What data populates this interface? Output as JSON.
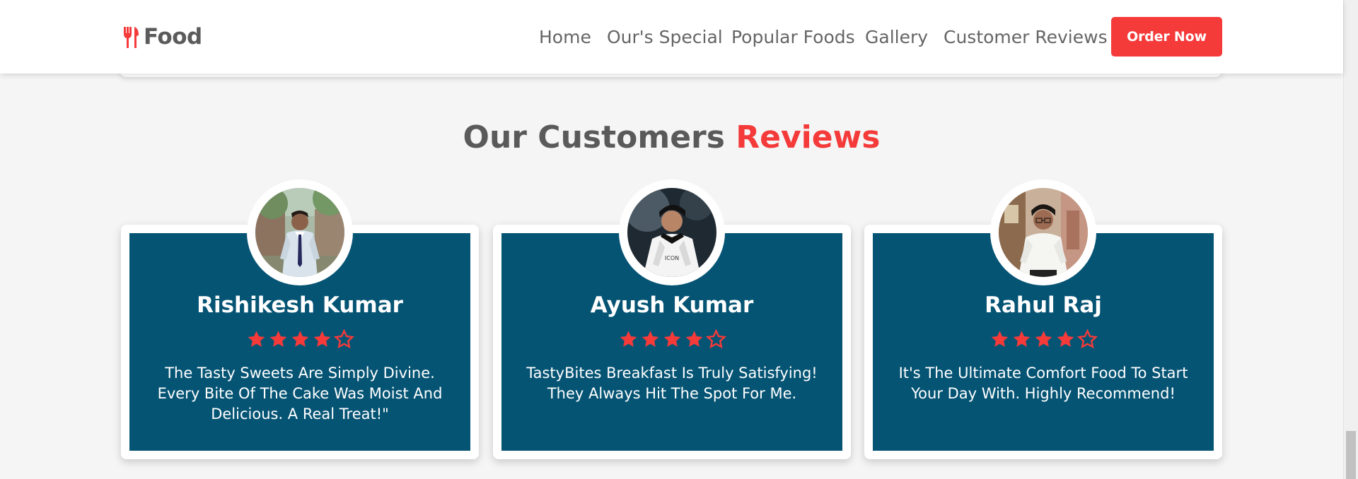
{
  "header": {
    "logo_text": "Food",
    "logo_icon": "fork-knife-icon",
    "nav": [
      {
        "label": "Home"
      },
      {
        "label": "Our's Special"
      },
      {
        "label": "Popular Foods"
      },
      {
        "label": "Gallery"
      },
      {
        "label": "Customer Reviews"
      }
    ],
    "order_button": "Order Now"
  },
  "reviews_section": {
    "title_prefix": "Our Customers",
    "title_accent": "Reviews",
    "cards": [
      {
        "name": "Rishikesh Kumar",
        "rating": 4,
        "max_rating": 5,
        "text": "The Tasty Sweets Are Simply Divine. Every Bite Of The Cake Was Moist And Delicious. A Real Treat!\""
      },
      {
        "name": "Ayush Kumar",
        "rating": 4,
        "max_rating": 5,
        "text": "TastyBites Breakfast Is Truly Satisfying! They Always Hit The Spot For Me."
      },
      {
        "name": "Rahul Raj",
        "rating": 4,
        "max_rating": 5,
        "text": "It's The Ultimate Comfort Food To Start Your Day With. Highly Recommend!"
      }
    ]
  },
  "colors": {
    "accent": "#f53a3a",
    "card_background": "#055474",
    "text_gray": "#5a5a5a"
  }
}
